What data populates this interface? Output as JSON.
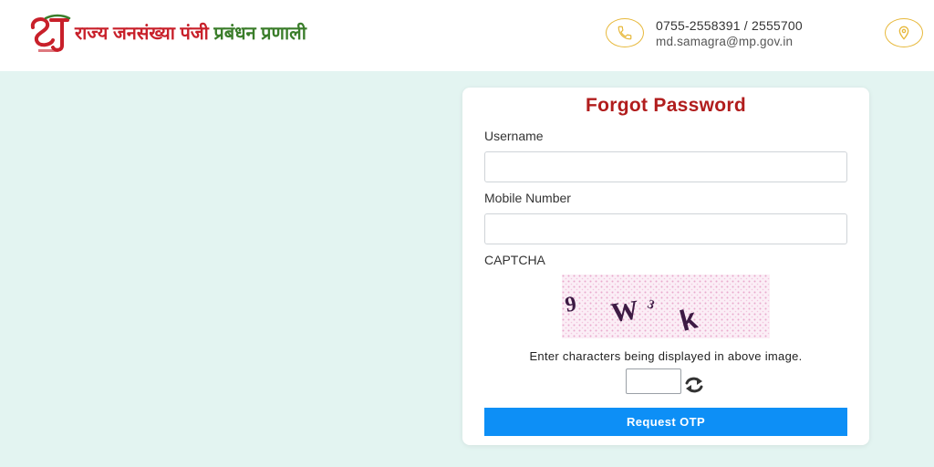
{
  "header": {
    "logo_icon": "samagra-logo",
    "title_part1": "राज्य जनसंख्या पंजी",
    "title_part2": "प्रबंधन प्रणाली",
    "phone": "0755-2558391 / 2555700",
    "email": "md.samagra@mp.gov.in",
    "phone_icon": "phone-icon",
    "location_icon": "location-pin-icon",
    "icon_color": "#e7b83a"
  },
  "form": {
    "title": "Forgot Password",
    "username_label": "Username",
    "username_value": "",
    "mobile_label": "Mobile Number",
    "mobile_value": "",
    "captcha_label": "CAPTCHA",
    "captcha_chars": [
      "9",
      "W",
      "3",
      "k"
    ],
    "captcha_hint": "Enter characters being displayed in above image.",
    "captcha_value": "",
    "refresh_icon": "refresh-icon",
    "submit_label": "Request OTP"
  },
  "colors": {
    "background": "#e3f4f1",
    "title": "#b11d1d",
    "button": "#0d8ff6"
  }
}
